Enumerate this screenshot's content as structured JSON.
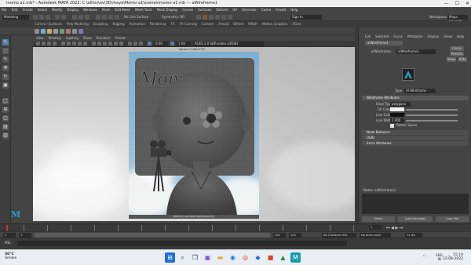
{
  "window": {
    "title": "momo a1.mb* - Autodesk MAYA 2022: C:\\all\\ov\\ov\\3D\\maya\\Momo a1\\scenes\\momo a1.mb --- aWireframe1",
    "controls": [
      "—",
      "☐",
      "✕"
    ]
  },
  "menubar": [
    "File",
    "Edit",
    "Create",
    "Select",
    "Modify",
    "Display",
    "Windows",
    "Mesh",
    "Edit Mesh",
    "Mesh Tools",
    "Mesh Display",
    "Curves",
    "Surfaces",
    "Deform",
    "UV",
    "Generate",
    "Cache",
    "Arnold",
    "Help"
  ],
  "statusline": {
    "mode": "Modeling",
    "symmetry": "Symmetry: Off",
    "no_live_surface": "No Live Surface",
    "workspace_label": "Workspace:",
    "workspace_value": "Maya Classic*",
    "sign_in": "Sign In"
  },
  "shelf_tabs": [
    "Curves / Surfaces",
    "Poly Modeling",
    "Sculpting",
    "Rigging",
    "Animation",
    "Rendering",
    "FX",
    "FX Caching",
    "Custom",
    "Arnold",
    "Bifrost",
    "MASH",
    "Motion Graphics",
    "XGen"
  ],
  "panel": {
    "menu": [
      "View",
      "Shading",
      "Lighting",
      "Show",
      "Renderer",
      "Panels"
    ],
    "fields": {
      "near": "0.00",
      "far": "1.00",
      "colorspace": "ACES 1.0 SDR-video (sRGB)"
    },
    "gate_top": "persp1 (1280x720)",
    "gate_bottom": "pink:all_camera1(wireframe1)"
  },
  "attribute_editor": {
    "tabs": [
      "List",
      "Selected",
      "Focus",
      "Attributes",
      "Display",
      "Show",
      "Help"
    ],
    "node_tab": "aiWireframe1",
    "node_label": "aiWireframe:",
    "node_value": "aiWireframe1",
    "buttons": {
      "focus": "Focus",
      "presets": "Presets",
      "show": "Show",
      "hide": "Hide"
    },
    "type_label": "Type",
    "type_value": "AI Wireframe",
    "section_main": "Wireframe Attributes",
    "edge_type_label": "Edge Type",
    "edge_type_value": "polygons",
    "fill_color_label": "Fill Color",
    "line_color_label": "Line Color",
    "line_width_label": "Line Width",
    "line_width_value": "1.000",
    "raster_space_label": "Raster Space",
    "sections": [
      "Node Behavior",
      "UUID",
      "Extra Attributes"
    ],
    "notes_label": "Notes: aiWireframe1",
    "bottom_buttons": [
      "Select",
      "Load Attributes",
      "Copy Tab"
    ]
  },
  "time": {
    "ticks": [
      "1",
      "5",
      "10",
      "15",
      "20",
      "25",
      "30",
      "35",
      "40",
      "45",
      "50",
      "55",
      "60",
      "65",
      "70",
      "75",
      "80",
      "85",
      "90",
      "95",
      "100",
      "105",
      "110",
      "115",
      "120"
    ],
    "current": "1",
    "range_start": "1",
    "range_inner_start": "1",
    "range_inner_end": "120",
    "range_end": "120",
    "range_end2": "200",
    "character_set": "No Character Set",
    "anim_layer": "No Anim Layer",
    "fps": "24 fps"
  },
  "cmdline": {
    "label": "MEL"
  },
  "taskbar": {
    "temp": "30°C",
    "weather": "Smoke",
    "lang": "ENG",
    "region": "IN",
    "time": "15:19",
    "date": "12-08-2022"
  },
  "colors": {
    "maya_logo": "#2a9bc4",
    "blue_accent": "#5d7ea3",
    "render_blue": "#6aa0c3"
  }
}
